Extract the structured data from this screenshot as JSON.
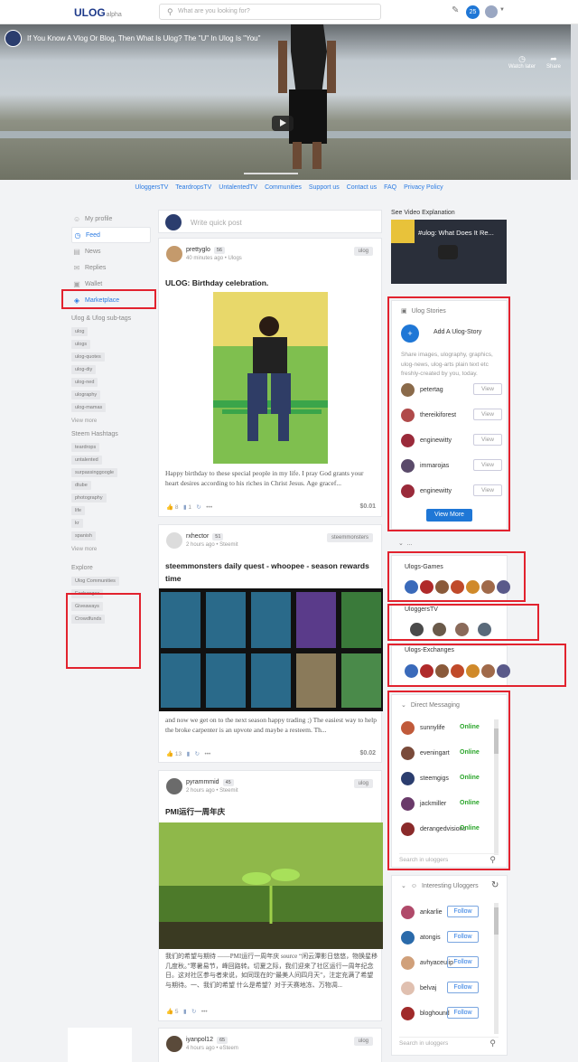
{
  "header": {
    "logo": "ULOG",
    "logo_suffix": "alpha",
    "search_placeholder": "What are you looking for?",
    "notification_count": "25"
  },
  "video": {
    "title": "If You Know A Vlog Or Blog, Then What Is Ulog? The \"U\" In Ulog Is \"You\"",
    "watch_later": "Watch later",
    "share": "Share"
  },
  "nav": [
    "UloggersTV",
    "TeardropsTV",
    "UntalentedTV",
    "Communities",
    "Support us",
    "Contact us",
    "FAQ",
    "Privacy Policy"
  ],
  "sidebar": {
    "items": [
      {
        "label": "My profile",
        "icon": "user-icon"
      },
      {
        "label": "Feed",
        "icon": "clock-icon"
      },
      {
        "label": "News",
        "icon": "news-icon"
      },
      {
        "label": "Replies",
        "icon": "reply-icon"
      },
      {
        "label": "Wallet",
        "icon": "wallet-icon"
      },
      {
        "label": "Marketplace",
        "icon": "tag-icon"
      }
    ],
    "ulog_tags_title": "Ulog & Ulog sub-tags",
    "ulog_tags": [
      "ulog",
      "ulogs",
      "ulog-quotes",
      "ulog-diy",
      "ulog-ned",
      "ulography",
      "ulog-mamas"
    ],
    "view_more": "View more",
    "hashtags_title": "Steem Hashtags",
    "hashtags": [
      "teardrops",
      "untalented",
      "surpassinggoogle",
      "dtube",
      "photography",
      "life",
      "kr",
      "spanish"
    ],
    "explore_title": "Explore",
    "explore": [
      "Ulog Communities",
      "Exchanges",
      "Giveaways",
      "Crowdfunds"
    ]
  },
  "quick_post": {
    "placeholder": "Write quick post",
    "avatar_label": "STEEM GIGS"
  },
  "posts": [
    {
      "author": "prettyglo",
      "rep": "56",
      "time": "40 minutes ago",
      "community": "Ulogs",
      "tag": "ulog",
      "title": "ULOG: Birthday celebration.",
      "body": "Happy birthday to these special people in my life. I pray God grants your heart desires according to his riches in Christ Jesus. Age gracef...",
      "votes": "8",
      "comments": "1",
      "payout": "$0.01"
    },
    {
      "author": "rxhector",
      "rep": "51",
      "time": "2 hours ago",
      "community": "Steemit",
      "tag": "steemmonsters",
      "title": "steemmonsters daily quest - whoopee - season rewards time",
      "body": "and now we get on to the next season happy trading ;) The easiest way to help the broke carpenter is an upvote and maybe a resteem. Th...",
      "votes": "13",
      "comments": "",
      "payout": "$0.02"
    },
    {
      "author": "pyrammmid",
      "rep": "45",
      "time": "2 hours ago",
      "community": "Steemit",
      "tag": "ulog",
      "title": "PMI运行一周年庆",
      "body": "我们的希望与期待 ——PMI运行一周年庆 source “闲云潭影日悠悠，物换星移几度秋。”寒暑易节，峰回路转。切夏之际，我们迎来了社区运行一周年纪念日。这对社区参与者来说，如同现在的“最美人间四月天”，注定充满了希望与期待。一、我们的希望 什么是希望？对于天赛地冻、万物凋...",
      "votes": "5",
      "comments": "",
      "payout": ""
    },
    {
      "author": "iyanpol12",
      "rep": "65",
      "time": "4 hours ago",
      "community": "eSteem",
      "tag": "ulog",
      "title": "",
      "body": "",
      "votes": "",
      "comments": "",
      "payout": ""
    }
  ],
  "right": {
    "video_explanation_title": "See Video Explanation",
    "video_explanation_caption": "#ulog: What Does It Re...",
    "stories_title": "Ulog Stories",
    "add_story": "Add A Ulog-Story",
    "stories_desc": "Share images, ulography, graphics, ulog-news, ulog-arts plain text etc freshly-created by you, today.",
    "stories": [
      "petertag",
      "thereikiforest",
      "enginewitty",
      "immarojas",
      "enginewitty"
    ],
    "view_label": "View",
    "view_more_btn": "View More",
    "collapsed_label": "...",
    "games_title": "Ulogs-Games",
    "tv_title": "UloggersTV",
    "exchanges_title": "Ulogs-Exchanges",
    "dm_title": "Direct Messaging",
    "dm": [
      "sunnylife",
      "eveningart",
      "steemgigs",
      "jackmiller",
      "derangedvisions"
    ],
    "online_label": "Online",
    "search_uloggers": "Search in uloggers",
    "interesting_title": "Interesting Uloggers",
    "interesting": [
      "ankarlie",
      "atongis",
      "avhyaceulip",
      "belvaj",
      "bloghound"
    ],
    "follow_label": "Follow"
  },
  "colors": {
    "accent": "#2a7ae2",
    "highlight_box": "#e2222e",
    "online": "#2aa52a",
    "button": "#1f77d6"
  }
}
